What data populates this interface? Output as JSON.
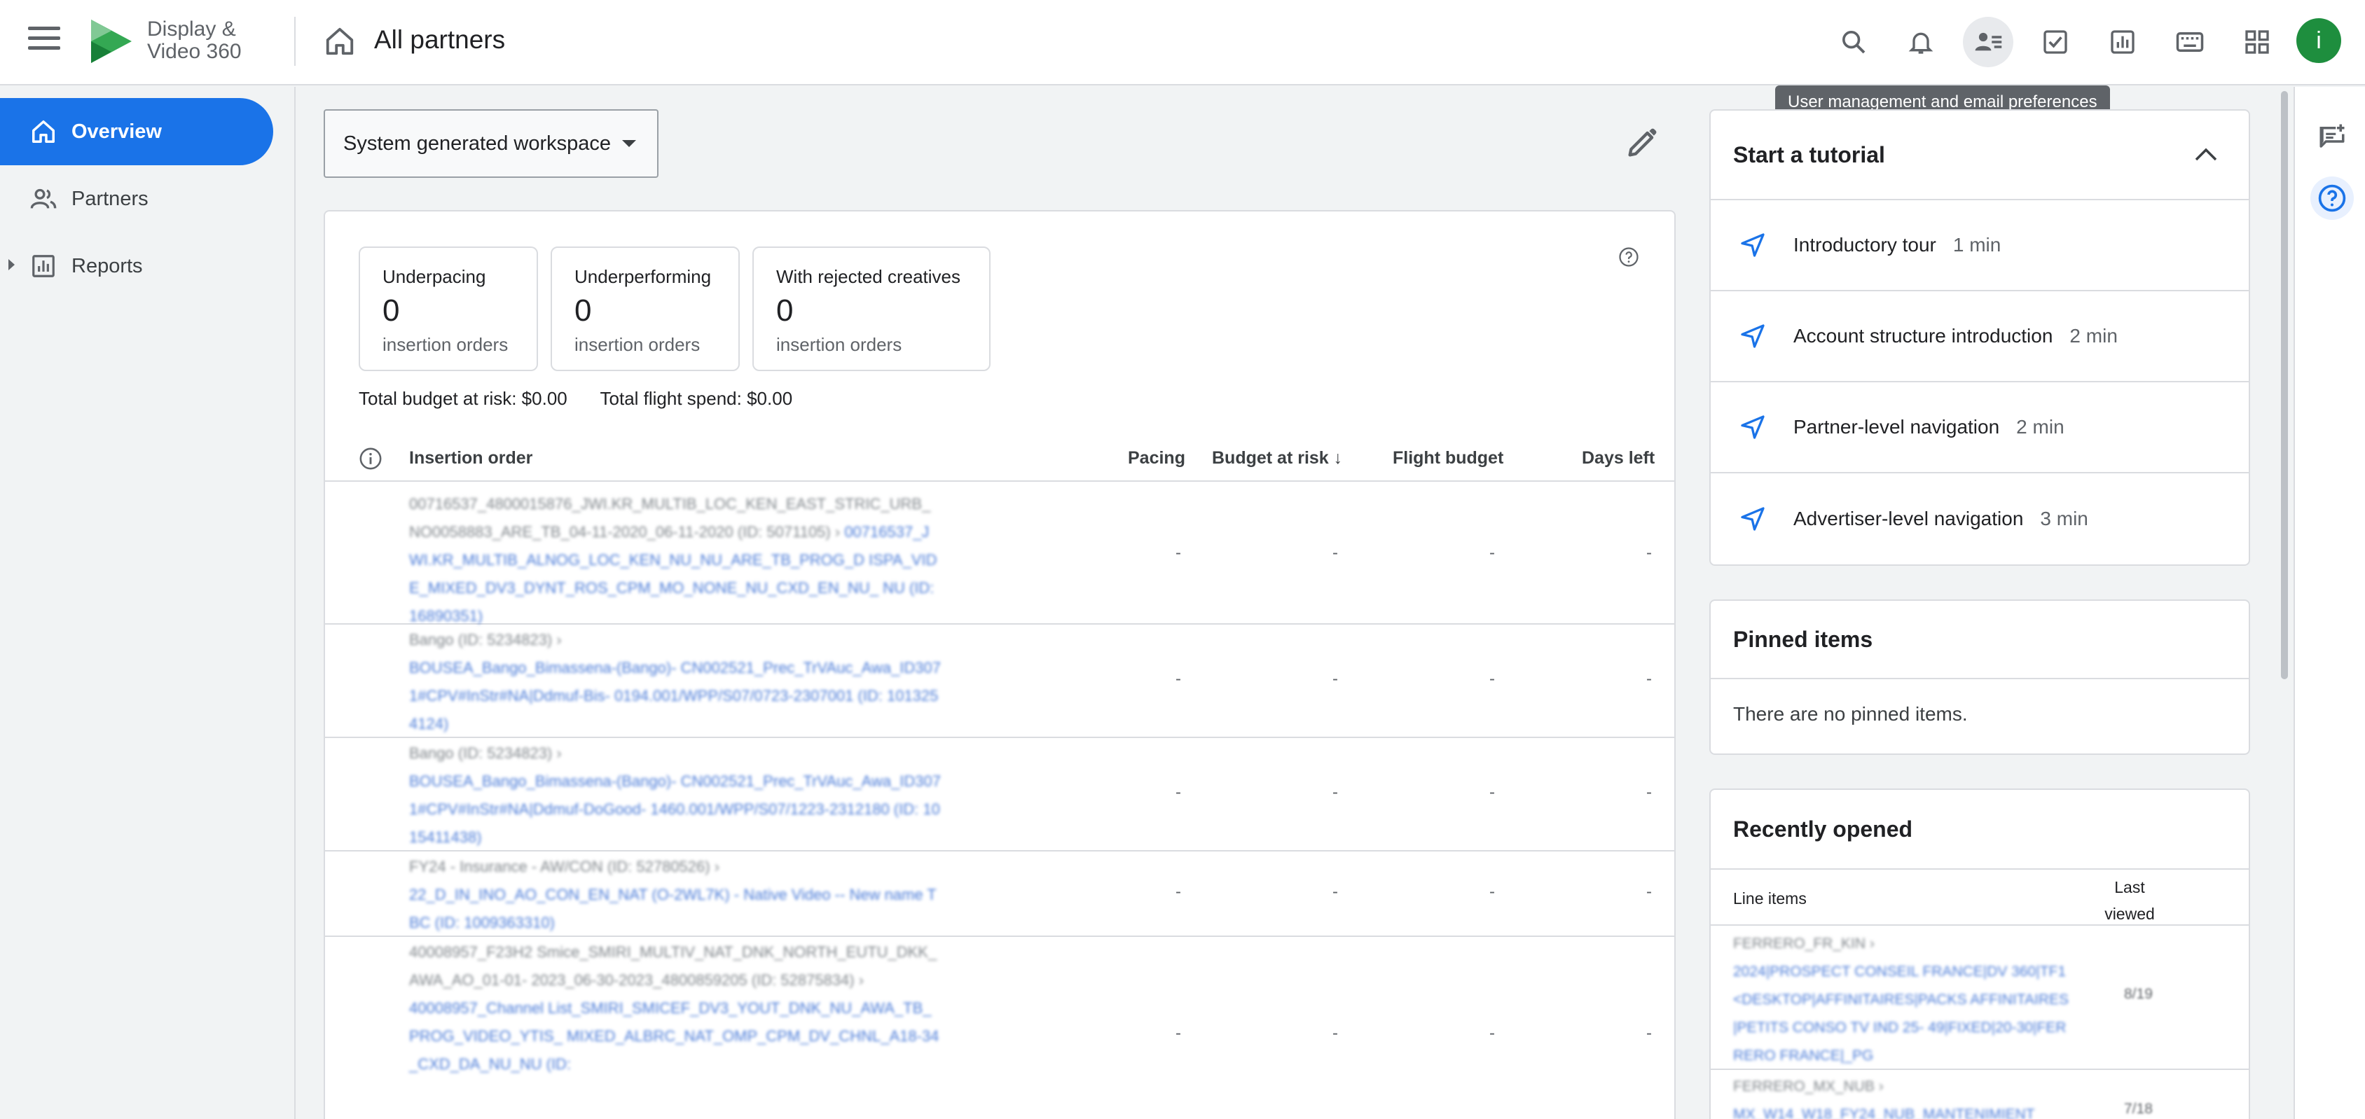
{
  "app": {
    "brand_line1": "Display &",
    "brand_line2": "Video 360",
    "page_title": "All partners"
  },
  "toolbar": {
    "tooltip": "User management and email preferences",
    "avatar_initial": "i",
    "icons": [
      "search-icon",
      "notifications-icon",
      "user-management-icon",
      "tasks-icon",
      "reports-icon",
      "keyboard-icon",
      "apps-grid-icon"
    ]
  },
  "sidebar": {
    "items": [
      {
        "label": "Overview",
        "icon": "home-icon",
        "active": true
      },
      {
        "label": "Partners",
        "icon": "people-icon",
        "active": false
      },
      {
        "label": "Reports",
        "icon": "bar-chart-icon",
        "active": false
      }
    ]
  },
  "workspace": {
    "label": "System generated workspace"
  },
  "summary": {
    "cards": [
      {
        "title": "Underpacing",
        "count": "0",
        "unit": "insertion orders"
      },
      {
        "title": "Underperforming",
        "count": "0",
        "unit": "insertion orders"
      },
      {
        "title": "With rejected creatives",
        "count": "0",
        "unit": "insertion orders"
      }
    ],
    "total_budget_at_risk": "Total budget at risk: $0.00",
    "total_flight_spend": "Total flight spend: $0.00"
  },
  "table": {
    "columns": [
      "Insertion order",
      "Pacing",
      "Budget at risk ↓",
      "Flight budget",
      "Days left"
    ],
    "rows": [
      {
        "parent": "00716537_4800015876_JWI.KR_MULTIB_LOC_KEN_EAST_STRIC_URB_ NO0058883_ARE_TB_04-11-2020_06-11-2020 (ID: 5071105) ›",
        "link": "00716537_JWI.KR_MULTIB_ALNOG_LOC_KEN_NU_NU_ARE_TB_PROG_D ISPA_VIDE_MIXED_DV3_DYNT_ROS_CPM_MO_NONE_NU_CXD_EN_NU_ NU (ID: 16890351)",
        "pacing": "-",
        "budget_at_risk": "-",
        "flight_budget": "-",
        "days_left": "-"
      },
      {
        "parent": "Bango (ID: 5234823) ›",
        "link": "BOUSEA_Bango_Bimassena-(Bango)- CN002521_Prec_TrVAuc_Awa_ID3071#CPV#InStr#NA|Ddmuf-Bis- 0194.001/WPP/S07/0723-2307001 (ID: 1013254124)",
        "pacing": "-",
        "budget_at_risk": "-",
        "flight_budget": "-",
        "days_left": "-"
      },
      {
        "parent": "Bango (ID: 5234823) ›",
        "link": "BOUSEA_Bango_Bimassena-(Bango)- CN002521_Prec_TrVAuc_Awa_ID3071#CPV#InStr#NA|Ddmuf-DoGood- 1460.001/WPP/S07/1223-2312180 (ID: 1015411438)",
        "pacing": "-",
        "budget_at_risk": "-",
        "flight_budget": "-",
        "days_left": "-"
      },
      {
        "parent": "FY24 - Insurance - AW/CON (ID: 52780526) ›",
        "link": "22_D_IN_INO_AO_CON_EN_NAT (O-2WL7K) - Native Video -- New name TBC (ID: 1009363310)",
        "pacing": "-",
        "budget_at_risk": "-",
        "flight_budget": "-",
        "days_left": "-"
      },
      {
        "parent": "40008957_F23H2 Smice_SMIRI_MULTIV_NAT_DNK_NORTH_EUTU_DKK_AWA_AO_01-01- 2023_06-30-2023_4800859205 (ID: 52875834) ›",
        "link": "40008957_Channel List_SMIRI_SMICEF_DV3_YOUT_DNK_NU_AWA_TB_PROG_VIDEO_YTIS_ MIXED_ALBRC_NAT_OMP_CPM_DV_CHNL_A18-34_CXD_DA_NU_NU (ID:",
        "pacing": "-",
        "budget_at_risk": "-",
        "flight_budget": "-",
        "days_left": "-"
      }
    ]
  },
  "tutorial": {
    "title": "Start a tutorial",
    "items": [
      {
        "label": "Introductory tour",
        "duration": "1 min"
      },
      {
        "label": "Account structure introduction",
        "duration": "2 min"
      },
      {
        "label": "Partner-level navigation",
        "duration": "2 min"
      },
      {
        "label": "Advertiser-level navigation",
        "duration": "3 min"
      }
    ]
  },
  "pinned": {
    "title": "Pinned items",
    "empty": "There are no pinned items."
  },
  "recent": {
    "title": "Recently opened",
    "col_item": "Line items",
    "col_viewed_1": "Last",
    "col_viewed_2": "viewed",
    "rows": [
      {
        "parent": "FERRERO_FR_KIN ›",
        "link": "2024|PROSPECT CONSEIL FRANCE|DV 360|TF1<DESKTOP|AFFINITAIRES|PACKS AFFINITAIRES|PETITS CONSO TV IND 25- 49|FIXED|20-30|FERRERO FRANCE|_PG",
        "viewed": "8/19"
      },
      {
        "parent": "FERRERO_MX_NUB ›",
        "link": "MX_W14_W18_FY24_NUB_MANTENIMIENT",
        "viewed": "7/18"
      }
    ]
  },
  "colors": {
    "accent": "#1a73e8",
    "avatar": "#1e8e3e"
  }
}
